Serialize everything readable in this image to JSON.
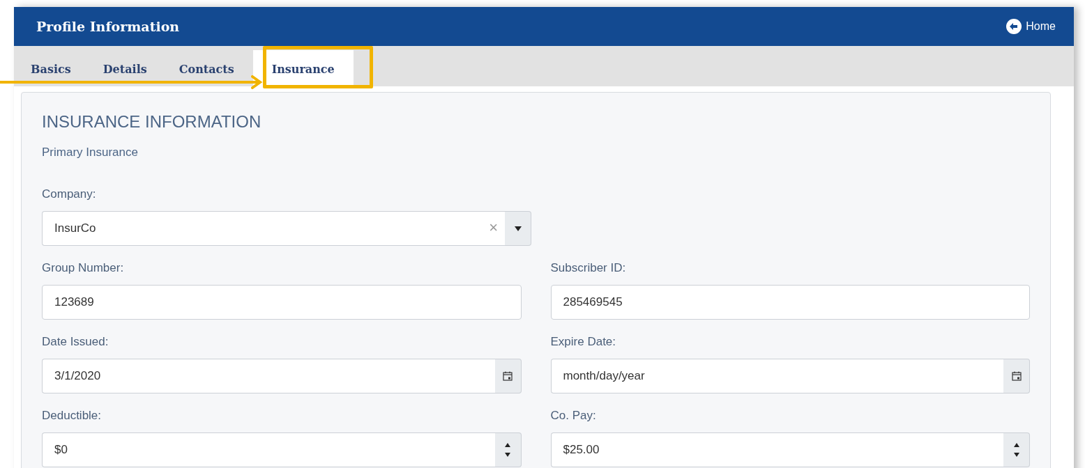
{
  "header": {
    "title": "Profile Information",
    "home_link": "Home"
  },
  "tabs": [
    {
      "label": "Basics",
      "selected": false
    },
    {
      "label": "Details",
      "selected": false
    },
    {
      "label": "Contacts",
      "selected": false
    },
    {
      "label": "Insurance",
      "selected": true
    }
  ],
  "card": {
    "heading": "INSURANCE INFORMATION",
    "subheading": "Primary Insurance",
    "rows": [
      [
        {
          "kind": "select",
          "label": "Company:",
          "value": "InsurCo",
          "clear_icon": "×"
        }
      ],
      [
        {
          "kind": "text",
          "label": "Group Number:",
          "value": "123689"
        },
        {
          "kind": "text",
          "label": "Subscriber ID:",
          "value": "285469545"
        }
      ],
      [
        {
          "kind": "date",
          "label": "Date Issued:",
          "value": "3/1/2020"
        },
        {
          "kind": "date",
          "label": "Expire Date:",
          "placeholder": "month/day/year"
        }
      ],
      [
        {
          "kind": "number",
          "label": "Deductible:",
          "value": "$0"
        },
        {
          "kind": "number",
          "label": "Co. Pay:",
          "value": "$25.00"
        }
      ]
    ]
  }
}
